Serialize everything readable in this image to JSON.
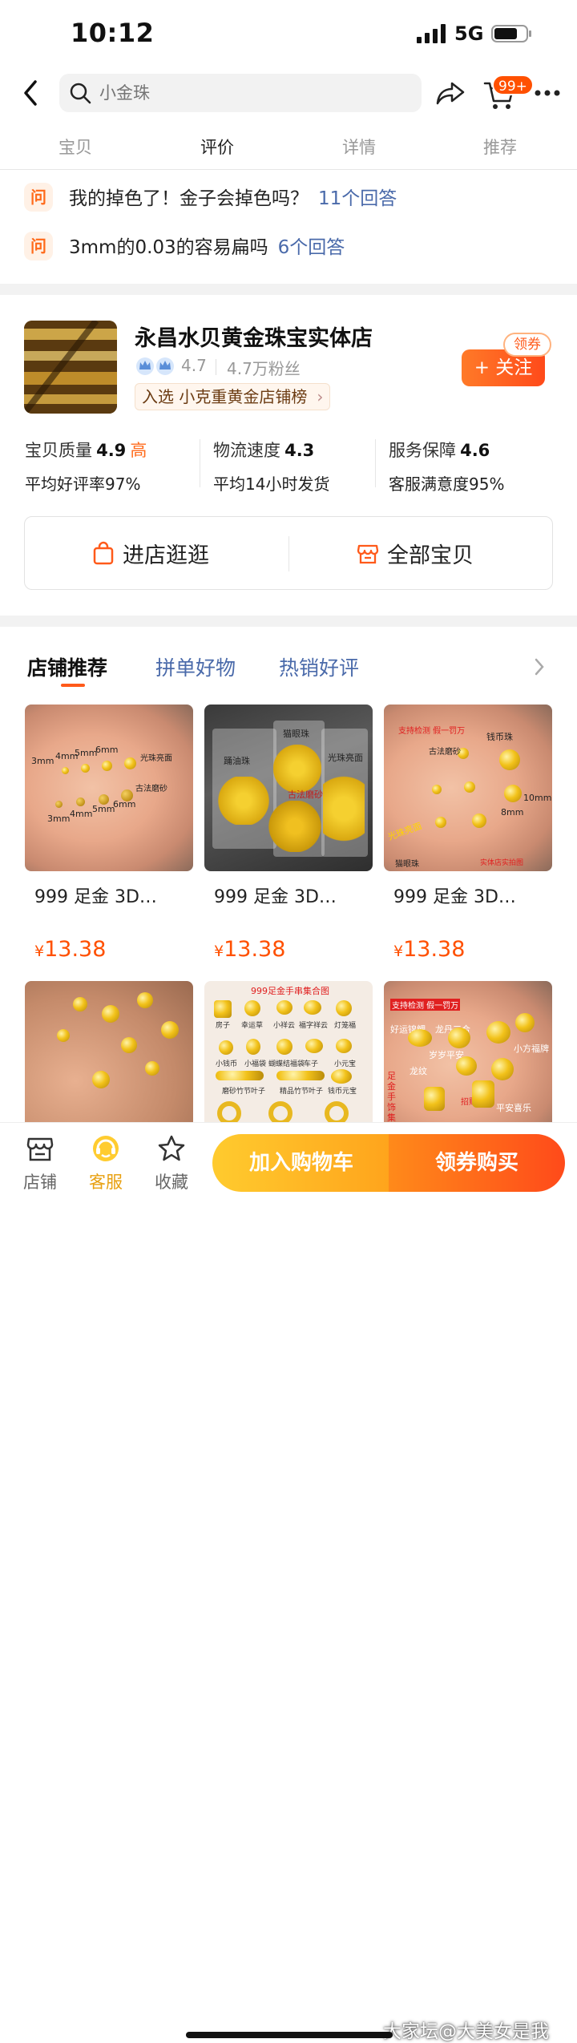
{
  "status_bar": {
    "time": "10:12",
    "network": "5G"
  },
  "header": {
    "search_placeholder": "小金珠",
    "cart_badge": "99+"
  },
  "tabs": [
    "宝贝",
    "评价",
    "详情",
    "推荐"
  ],
  "active_tab": "评价",
  "questions": [
    {
      "icon": "问",
      "text": "我的掉色了！金子会掉色吗？",
      "answers": "11个回答"
    },
    {
      "icon": "问",
      "text": "3mm的0.03的容易扁吗",
      "answers": "6个回答"
    }
  ],
  "shop": {
    "name": "永昌水贝黄金珠宝实体店",
    "rating": "4.7",
    "fans": "4.7万粉丝",
    "rank_text": "入选 小克重黄金店铺榜",
    "coupon_label": "领券",
    "follow_label": "+ 关注",
    "metrics": [
      {
        "name": "宝贝质量",
        "value": "4.9",
        "tag": "高",
        "sub": "平均好评率97%"
      },
      {
        "name": "物流速度",
        "value": "4.3",
        "tag": "",
        "sub": "平均14小时发货"
      },
      {
        "name": "服务保障",
        "value": "4.6",
        "tag": "",
        "sub": "客服满意度95%"
      }
    ],
    "enter_store_label": "进店逛逛",
    "all_items_label": "全部宝贝"
  },
  "recommend": {
    "tabs": [
      "店铺推荐",
      "拼单好物",
      "热销好评"
    ],
    "active_tab": "店铺推荐",
    "products": [
      {
        "title": "999 足金 3D…",
        "currency": "¥",
        "price": "13.38",
        "image_labels": [
          "3mm",
          "4mm",
          "5mm",
          "6mm",
          "光珠亮面",
          "古法磨砂",
          "3mm",
          "4mm",
          "5mm",
          "6mm"
        ]
      },
      {
        "title": "999 足金 3D…",
        "currency": "¥",
        "price": "13.38",
        "image_labels": [
          "踊油珠",
          "猫眼珠",
          "光珠亮面",
          "古法磨砂"
        ]
      },
      {
        "title": "999 足金 3D…",
        "currency": "¥",
        "price": "13.38",
        "image_labels": [
          "支持检测 假一罚万",
          "钱币珠",
          "古法磨砂",
          "光珠亮面",
          "猫眼珠",
          "实体店实拍图",
          "8mm",
          "10mm"
        ]
      },
      {
        "title": "",
        "image_labels": []
      },
      {
        "title": "",
        "image_labels": [
          "999足金手串集合图",
          "房子",
          "幸运草",
          "小祥云",
          "福字祥云",
          "灯笼福",
          "小钱币",
          "小福袋",
          "蝴蝶结福袋",
          "车子",
          "小元宝",
          "磨砂竹节叶子",
          "精品竹节叶子",
          "钱币元宝"
        ]
      },
      {
        "title": "",
        "image_labels": [
          "支持检测 假一罚万",
          "好运锦鲤",
          "龙丹三合",
          "岁岁平安",
          "小方福牌",
          "龙纹",
          "招财",
          "平安喜乐",
          "足金手饰集合"
        ]
      }
    ]
  },
  "bottom_bar": {
    "store_label": "店铺",
    "service_label": "客服",
    "favorite_label": "收藏",
    "add_to_cart_label": "加入购物车",
    "buy_label": "领券购买"
  },
  "watermark": "大家坛@大美女是我",
  "colors": {
    "accent": "#ff5000",
    "link": "#4a6aaa",
    "gold": "#f2c21a"
  }
}
